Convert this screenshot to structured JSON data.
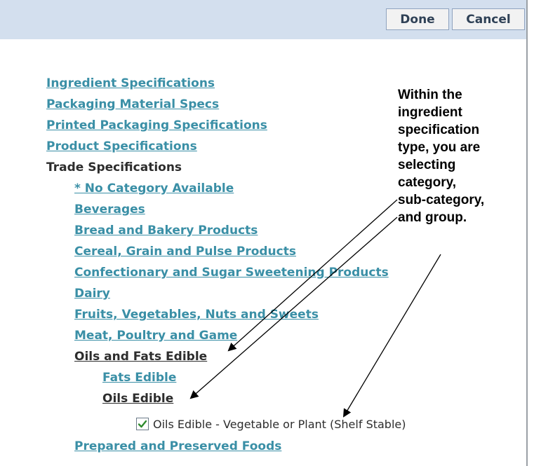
{
  "toolbar": {
    "done_label": "Done",
    "cancel_label": "Cancel"
  },
  "tree": {
    "types": [
      "Ingredient Specifications",
      "Packaging Material Specs",
      "Printed Packaging Specifications",
      "Product Specifications"
    ],
    "selected_type": "Trade Specifications",
    "categories": [
      "* No Category Available",
      "Beverages",
      "Bread and Bakery Products",
      "Cereal, Grain and Pulse Products",
      "Confectionary and Sugar Sweetening Products",
      "Dairy",
      "Fruits, Vegetables, Nuts and Sweets",
      "Meat, Poultry and Game"
    ],
    "selected_category": "Oils and Fats Edible",
    "subcategories": {
      "fats": "Fats Edible",
      "oils": "Oils Edible"
    },
    "group": {
      "label": "Oils Edible - Vegetable or Plant (Shelf Stable)",
      "checked": true
    },
    "last_category": "Prepared and Preserved Foods"
  },
  "callout": {
    "text": "Within the\ningredient\nspecification\ntype, you are\nselecting\ncategory,\nsub-category,\nand group."
  },
  "colors": {
    "link": "#3a8fa6",
    "header_band": "#d3dfee",
    "check": "#2e8b2e"
  }
}
